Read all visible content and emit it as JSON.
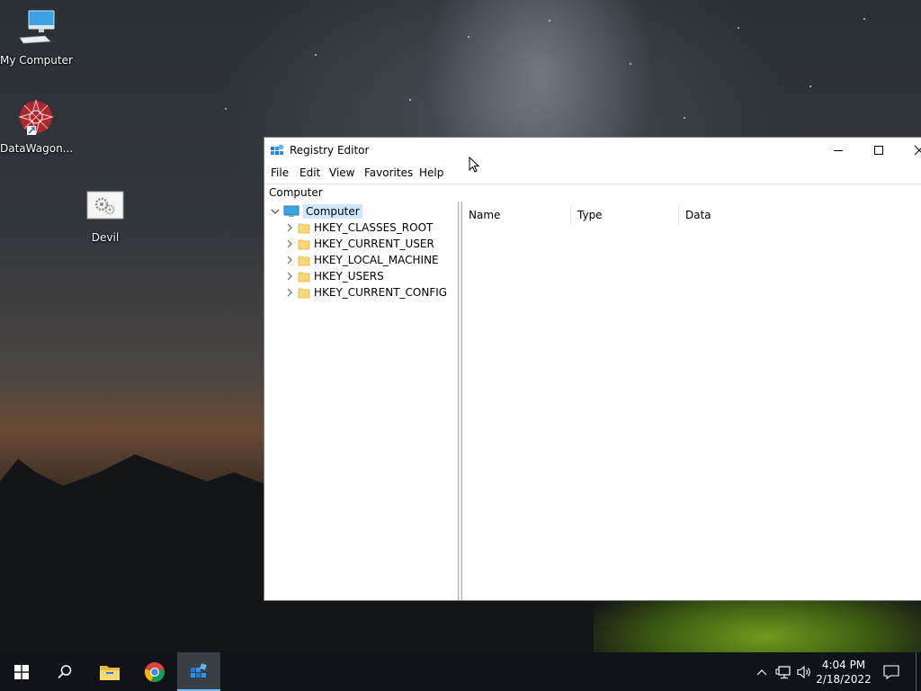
{
  "desktop": {
    "icons": [
      {
        "label": "My Computer",
        "icon": "my-computer-icon"
      },
      {
        "label": "DataWagon...",
        "icon": "datawagon-icon"
      },
      {
        "label": "Devil",
        "icon": "devil-settings-icon"
      }
    ]
  },
  "window": {
    "title": "Registry Editor",
    "controls": {
      "minimize": "minimize-icon",
      "maximize": "maximize-icon",
      "close": "close-icon"
    },
    "menu": [
      "File",
      "Edit",
      "View",
      "Favorites",
      "Help"
    ],
    "address": "Computer",
    "tree": {
      "root": "Computer",
      "hives": [
        "HKEY_CLASSES_ROOT",
        "HKEY_CURRENT_USER",
        "HKEY_LOCAL_MACHINE",
        "HKEY_USERS",
        "HKEY_CURRENT_CONFIG"
      ]
    },
    "list": {
      "columns": [
        "Name",
        "Type",
        "Data"
      ],
      "rows": []
    }
  },
  "taskbar": {
    "items": [
      "start-icon",
      "search-icon",
      "file-explorer-icon",
      "chrome-icon",
      "registry-editor-icon"
    ],
    "active_item": "registry-editor-icon",
    "tray": [
      "chevron-up-icon",
      "network-icon",
      "volume-icon"
    ],
    "time": "4:04 PM",
    "date": "2/18/2022",
    "notification": "notification-icon"
  },
  "colors": {
    "selection": "#cce8ff",
    "taskbar": "#101419",
    "active_task": "#3a3f46",
    "folder": "#f8d775"
  }
}
